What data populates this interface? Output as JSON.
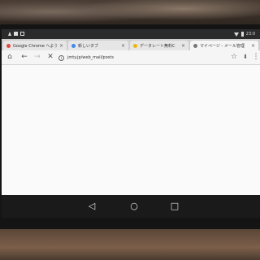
{
  "status_bar": {
    "left_icons": [
      "warning-icon",
      "image-icon",
      "download-icon"
    ],
    "right_icons": [
      "wifi-icon",
      "battery-icon"
    ],
    "time": "23:0"
  },
  "tabs": [
    {
      "title": "Google Chrome へようこそ",
      "favicon_color": "#e8453c",
      "active": false
    },
    {
      "title": "新しいタブ",
      "favicon_color": "#4285f4",
      "active": false
    },
    {
      "title": "データレート無料C",
      "favicon_color": "#f4b400",
      "active": false
    },
    {
      "title": "マイページ - メール管理",
      "favicon_color": "#777777",
      "active": true
    }
  ],
  "toolbar": {
    "url": "jmty.jp/web_mail/posts",
    "home_icon": "⌂",
    "back_icon": "←",
    "forward_icon": "→",
    "stop_icon": "✕",
    "star_icon": "☆",
    "download_icon": "⬇",
    "menu_icon": "⋮",
    "info_icon": "i"
  },
  "nav": {
    "back": "◁",
    "home": "○",
    "recents": "□"
  }
}
